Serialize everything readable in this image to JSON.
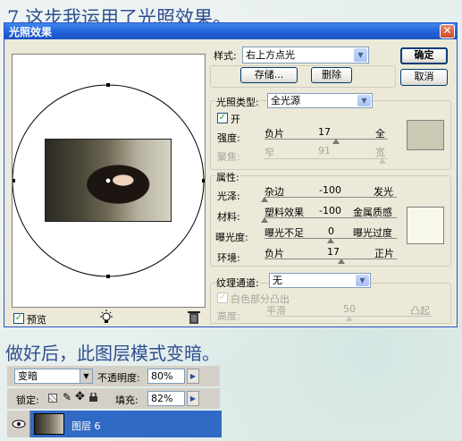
{
  "step_title": "7.这步我运用了光照效果。",
  "step_note": "做好后，此图层模式变暗。",
  "dialog": {
    "title": "光照效果",
    "close_glyph": "✕",
    "ok_label": "确定",
    "cancel_label": "取消",
    "preview_label": "预览",
    "style": {
      "label": "样式:",
      "value": "右上方点光",
      "save_label": "存储...",
      "delete_label": "删除"
    },
    "light_type": {
      "label": "光照类型:",
      "value": "全光源",
      "on_label": "开",
      "intensity": {
        "label": "强度:",
        "left": "负片",
        "value": "17",
        "right": "全",
        "level": 0.58
      },
      "focus": {
        "label": "聚焦:",
        "left": "窄",
        "value": "91",
        "right": "宽",
        "level": 0.96
      },
      "swatch_color": "#c9c9b4"
    },
    "properties": {
      "label": "属性:",
      "gloss": {
        "label": "光泽:",
        "left": "杂边",
        "value": "-100",
        "right": "发光",
        "level": 0.0
      },
      "material": {
        "label": "材料:",
        "left": "塑料效果",
        "value": "-100",
        "right": "金属质感",
        "level": 0.0
      },
      "exposure": {
        "label": "曝光度:",
        "left": "曝光不足",
        "value": "0",
        "right": "曝光过度",
        "level": 0.5
      },
      "ambience": {
        "label": "环境:",
        "left": "负片",
        "value": "17",
        "right": "正片",
        "level": 0.58
      },
      "swatch_color": "#f7f8e8"
    },
    "texture": {
      "label": "纹理通道:",
      "value": "无",
      "white_high_label": "白色部分凸出",
      "height": {
        "label": "高度:",
        "left": "平滑",
        "value": "50",
        "right": "凸起",
        "level": 0.5
      }
    }
  },
  "layers": {
    "blend_mode": "变暗",
    "opacity_label": "不透明度:",
    "opacity_value": "80%",
    "lock_label": "锁定:",
    "fill_label": "填充:",
    "fill_value": "82%",
    "layer_name": "图层 6"
  }
}
